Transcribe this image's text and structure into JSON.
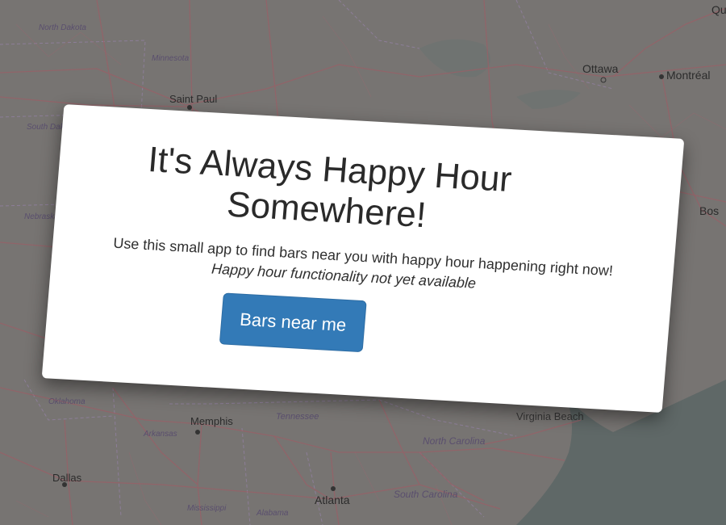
{
  "map": {
    "cities": [
      {
        "name": "Ottawa"
      },
      {
        "name": "Montréal"
      },
      {
        "name": "Saint Paul"
      },
      {
        "name": "Memphis"
      },
      {
        "name": "Dallas"
      },
      {
        "name": "Atlanta"
      },
      {
        "name": "Bos"
      },
      {
        "name": "Qu"
      }
    ],
    "regions": [
      {
        "name": "North Dakota"
      },
      {
        "name": "Minnesota"
      },
      {
        "name": "South Dako"
      },
      {
        "name": "Nebraska"
      },
      {
        "name": "Oklahoma"
      },
      {
        "name": "Arkansas"
      },
      {
        "name": "Tennessee"
      },
      {
        "name": "North Carolina"
      },
      {
        "name": "South Carolina"
      },
      {
        "name": "Mississippi"
      },
      {
        "name": "Alabama"
      }
    ],
    "partial_label": "Virginia Beach",
    "colors": {
      "land": "#777472",
      "water": "#5f6867",
      "roads": "#9a5f67",
      "borders": "#8f7f9c"
    }
  },
  "hero": {
    "title": "It's Always Happy Hour Somewhere!",
    "subtitle": "Use this small app to find bars near you with happy hour happening right now!",
    "note": "Happy hour functionality not yet available",
    "button_label": "Bars near me",
    "button_color": "#337ab7"
  }
}
